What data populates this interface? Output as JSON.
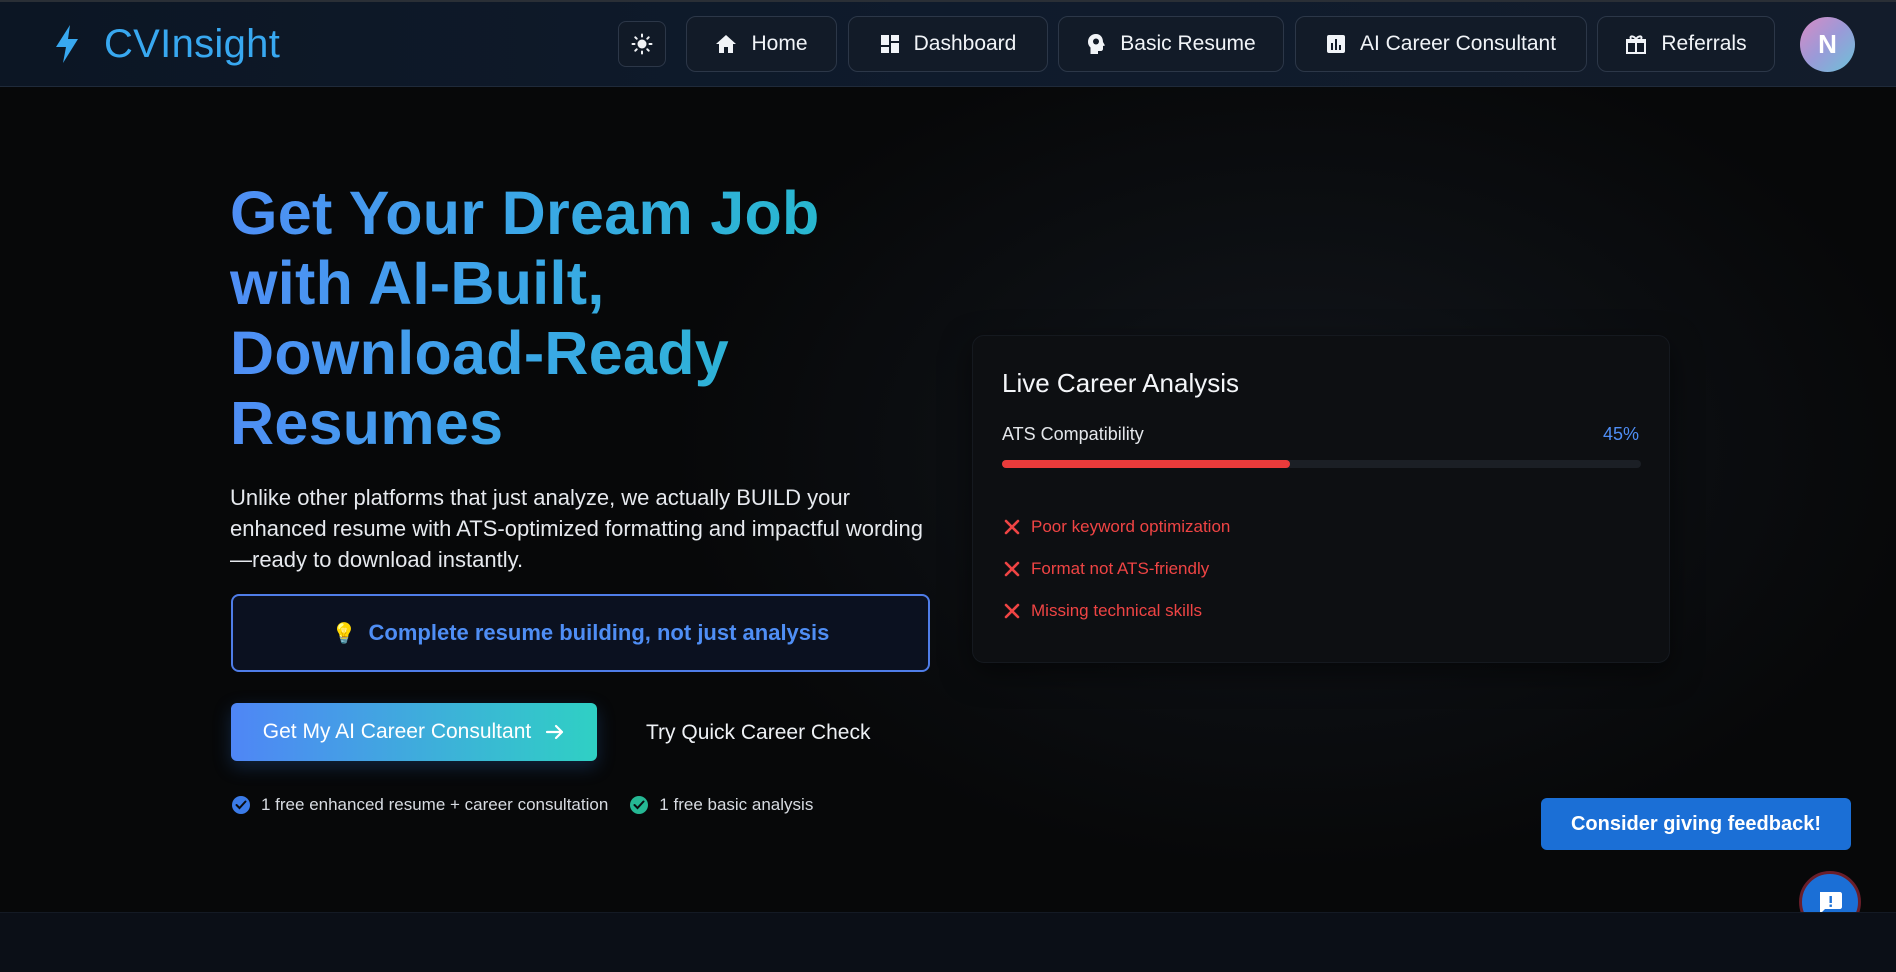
{
  "brand": {
    "name": "CVInsight"
  },
  "nav": {
    "items": [
      {
        "label": "Home",
        "icon": "home-icon"
      },
      {
        "label": "Dashboard",
        "icon": "dashboard-icon"
      },
      {
        "label": "Basic Resume",
        "icon": "head-bulb-icon"
      },
      {
        "label": "AI Career Consultant",
        "icon": "bar-chart-icon"
      },
      {
        "label": "Referrals",
        "icon": "gift-icon"
      }
    ],
    "avatar_initial": "N",
    "theme_icon": "sun-icon"
  },
  "hero": {
    "headline": "Get Your Dream Job with AI-Built, Download-Ready Resumes",
    "subtext": "Unlike other platforms that just analyze, we actually BUILD your enhanced resume with ATS-optimized formatting and impactful wording—ready to download instantly.",
    "highlight": "Complete resume building, not just analysis",
    "cta_label": "Get My AI Career Consultant",
    "secondary_label": "Try Quick Career Check",
    "checks": [
      {
        "label": "1 free enhanced resume + career consultation",
        "color": "#3b7be8"
      },
      {
        "label": "1 free basic analysis",
        "color": "#25b894"
      }
    ]
  },
  "analysis": {
    "title": "Live Career Analysis",
    "metric_label": "ATS Compatibility",
    "metric_value": "45%",
    "metric_fraction": 0.45,
    "issues": [
      "Poor keyword optimization",
      "Format not ATS-friendly",
      "Missing technical skills"
    ]
  },
  "feedback": {
    "label": "Consider giving feedback!"
  },
  "colors": {
    "accent_blue": "#4f8ef5",
    "brand_cyan": "#38a8f0",
    "danger": "#ea3b3b",
    "feedback_blue": "#1b6fd6"
  }
}
